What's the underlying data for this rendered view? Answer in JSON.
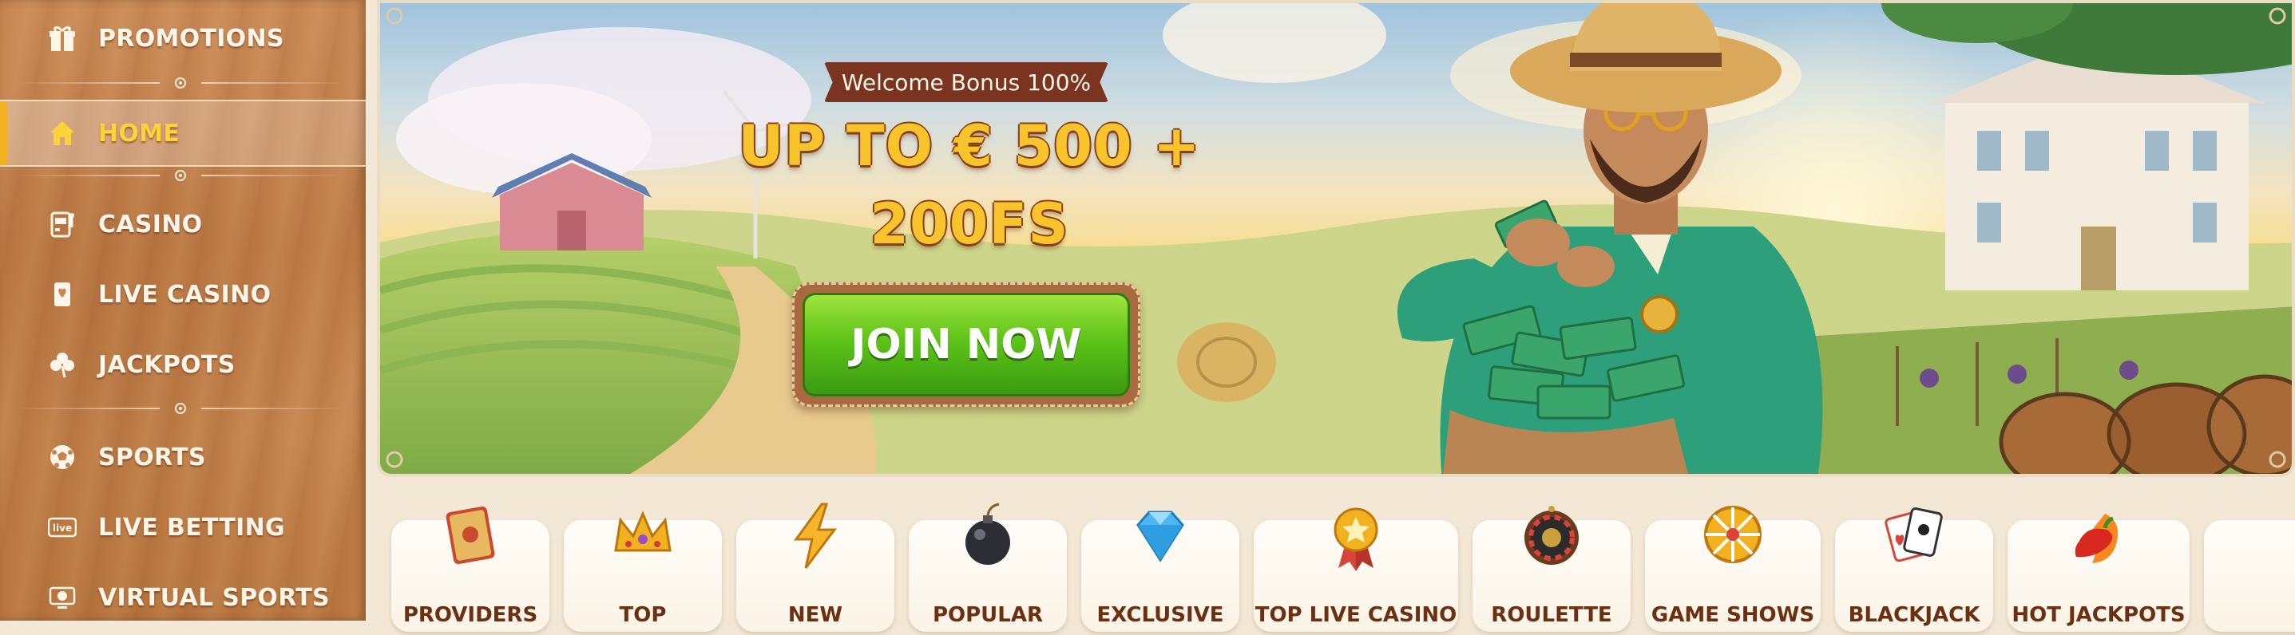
{
  "sidebar": {
    "items": [
      {
        "label": "PROMOTIONS",
        "icon": "gift-icon"
      },
      {
        "label": "HOME",
        "icon": "home-icon",
        "active": true
      },
      {
        "label": "CASINO",
        "icon": "slot-machine-icon"
      },
      {
        "label": "LIVE CASINO",
        "icon": "playing-card-icon"
      },
      {
        "label": "JACKPOTS",
        "icon": "clover-icon"
      },
      {
        "label": "SPORTS",
        "icon": "soccer-ball-icon"
      },
      {
        "label": "LIVE BETTING",
        "icon": "live-icon"
      },
      {
        "label": "VIRTUAL SPORTS",
        "icon": "virtual-sports-icon"
      }
    ],
    "live_badge": "live"
  },
  "banner": {
    "tag": "Welcome Bonus 100%",
    "headline_line1": "UP TO € 500 +",
    "headline_line2": "200FS",
    "cta_label": "JOIN NOW"
  },
  "categories": [
    {
      "label": "PROVIDERS",
      "icon": "book-icon"
    },
    {
      "label": "TOP",
      "icon": "crown-icon"
    },
    {
      "label": "NEW",
      "icon": "lightning-icon"
    },
    {
      "label": "POPULAR",
      "icon": "bomb-icon"
    },
    {
      "label": "EXCLUSIVE",
      "icon": "diamond-icon"
    },
    {
      "label": "TOP LIVE CASINO",
      "icon": "star-medal-icon"
    },
    {
      "label": "ROULETTE",
      "icon": "roulette-icon"
    },
    {
      "label": "GAME SHOWS",
      "icon": "wheel-of-fortune-icon"
    },
    {
      "label": "BLACKJACK",
      "icon": "cards-icon"
    },
    {
      "label": "HOT JACKPOTS",
      "icon": "chili-fire-icon"
    }
  ],
  "colors": {
    "sidebar_wood": "#c6864f",
    "active_accent": "#f2b21f",
    "active_text": "#ffd23a",
    "cta_green": "#5ec318",
    "headline_gold": "#f7c52b",
    "category_text": "#6b2f12"
  }
}
